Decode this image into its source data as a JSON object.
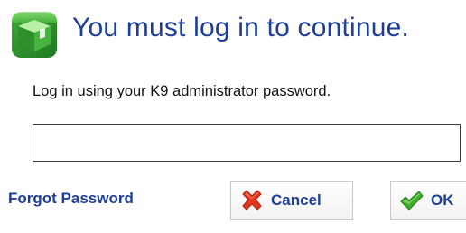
{
  "dialog": {
    "title": "You must log in to continue.",
    "instruction": "Log in using your K9 administrator password.",
    "password": {
      "value": "",
      "placeholder": ""
    },
    "forgot_password_label": "Forgot Password",
    "cancel_label": "Cancel",
    "ok_label": "OK"
  },
  "icons": {
    "logo": "green-box-icon",
    "cancel": "red-x-icon",
    "ok": "green-check-icon"
  },
  "colors": {
    "title": "#1f3f96",
    "link": "#1f3f96",
    "logo_green": "#3aa53a",
    "cancel_red": "#e23a22",
    "ok_green": "#3fae2a"
  }
}
